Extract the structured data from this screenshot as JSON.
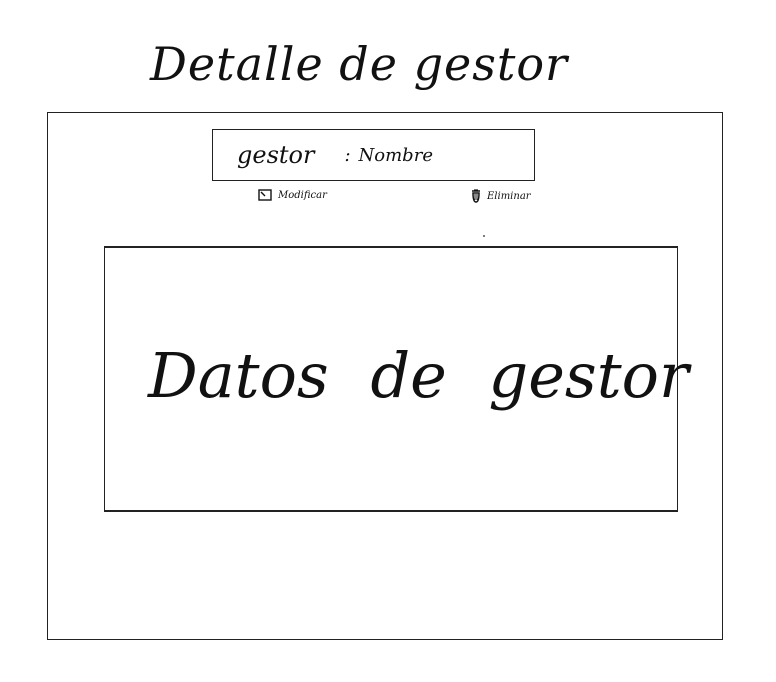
{
  "page": {
    "title": "Detalle de gestor"
  },
  "header": {
    "label": "gestor",
    "separator": ":",
    "value": "Nombre"
  },
  "actions": {
    "edit_label": "Modificar",
    "delete_label": "Eliminar",
    "edit_icon": "edit-icon",
    "delete_icon": "trash-icon"
  },
  "panel": {
    "text": "Datos de gestor"
  }
}
